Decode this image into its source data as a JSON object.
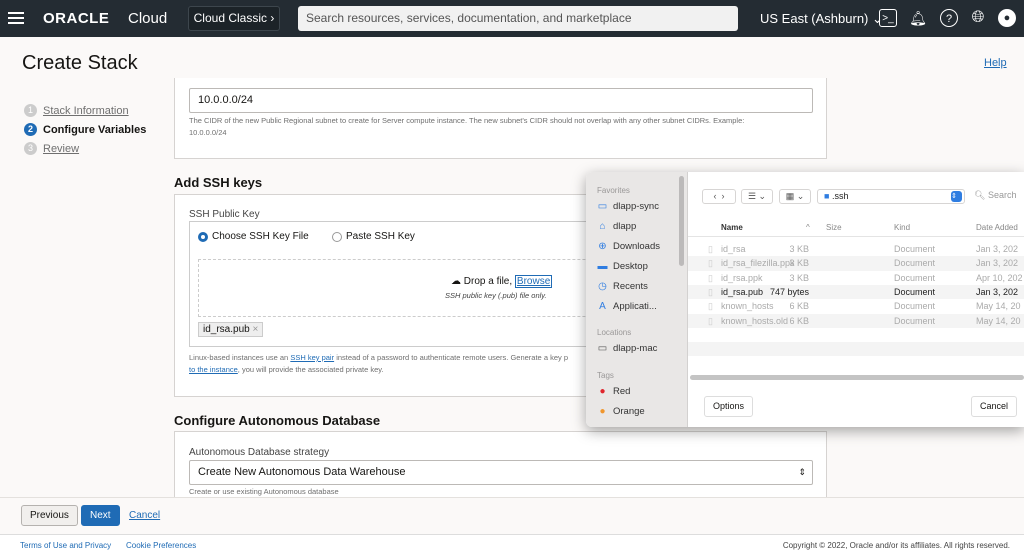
{
  "topbar": {
    "brand": "ORACLE",
    "brand_suffix": "Cloud",
    "classic": "Cloud Classic",
    "search_placeholder": "Search resources, services, documentation, and marketplace",
    "region": "US East (Ashburn)"
  },
  "page": {
    "title": "Create Stack",
    "help": "Help"
  },
  "steps": [
    {
      "num": "1",
      "label": "Stack Information"
    },
    {
      "num": "2",
      "label": "Configure Variables"
    },
    {
      "num": "3",
      "label": "Review"
    }
  ],
  "subnet": {
    "value": "10.0.0.0/24",
    "hint": "The CIDR of the new Public Regional subnet to create for Server compute instance. The new subnet's CIDR should not overlap with any other subnet CIDRs. Example:",
    "hint2": "10.0.0.0/24"
  },
  "ssh": {
    "heading": "Add SSH keys",
    "label": "SSH Public Key",
    "opt1": "Choose SSH Key File",
    "opt2": "Paste SSH Key",
    "drop": "Drop a file",
    "browse": "Browse",
    "drop_hint": "SSH public key (.pub) file only.",
    "file_chip": "id_rsa.pub",
    "help_pre": "Linux-based instances use an ",
    "help_link": "SSH key pair",
    "help_mid": " instead of a password to authenticate remote users. Generate a key p",
    "help_link2": "to the instance",
    "help_post": ", you will provide the associated private key."
  },
  "adb": {
    "heading": "Configure Autonomous Database",
    "label": "Autonomous Database strategy",
    "value": "Create New Autonomous Data Warehouse",
    "hint": "Create or use existing Autonomous database"
  },
  "actions": {
    "previous": "Previous",
    "next": "Next",
    "cancel": "Cancel"
  },
  "footer": {
    "terms": "Terms of Use and Privacy",
    "cookies": "Cookie Preferences",
    "copyright": "Copyright © 2022, Oracle and/or its affiliates. All rights reserved."
  },
  "dialog": {
    "favorites_label": "Favorites",
    "favorites": [
      "dlapp-sync",
      "dlapp",
      "Downloads",
      "Desktop",
      "Recents",
      "Applicati..."
    ],
    "locations_label": "Locations",
    "locations": [
      "dlapp-mac"
    ],
    "tags_label": "Tags",
    "tags": [
      {
        "name": "Red",
        "color": "#e0252c"
      },
      {
        "name": "Orange",
        "color": "#f0962d"
      }
    ],
    "folder": ".ssh",
    "search_placeholder": "Search",
    "columns": [
      "Name",
      "Size",
      "Kind",
      "Date Added"
    ],
    "files": [
      {
        "name": "id_rsa",
        "size": "3 KB",
        "kind": "Document",
        "date": "Jan 3, 202"
      },
      {
        "name": "id_rsa_filezilla.ppk",
        "size": "3 KB",
        "kind": "Document",
        "date": "Jan 3, 202"
      },
      {
        "name": "id_rsa.ppk",
        "size": "3 KB",
        "kind": "Document",
        "date": "Apr 10, 202"
      },
      {
        "name": "id_rsa.pub",
        "size": "747 bytes",
        "kind": "Document",
        "date": "Jan 3, 202"
      },
      {
        "name": "known_hosts",
        "size": "6 KB",
        "kind": "Document",
        "date": "May 14, 20"
      },
      {
        "name": "known_hosts.old",
        "size": "6 KB",
        "kind": "Document",
        "date": "May 14, 20"
      }
    ],
    "options": "Options",
    "cancel": "Cancel"
  },
  "colors": {
    "accent": "#1f6bb5",
    "topbar": "#242c33"
  }
}
